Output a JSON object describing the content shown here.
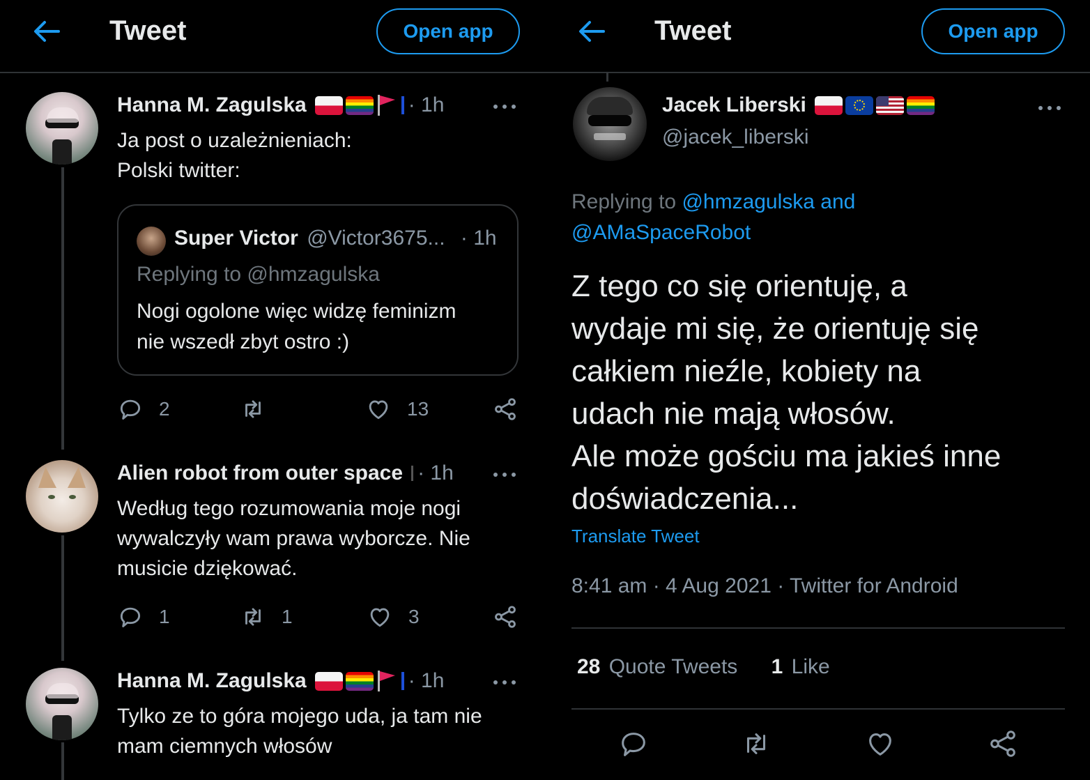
{
  "left": {
    "header": {
      "title": "Tweet",
      "open_app": "Open app"
    },
    "tweets": [
      {
        "name": "Hanna M. Zagulska",
        "time": "· 1h",
        "lines": [
          "Ja post o uzależnieniach:",
          "Polski twitter:"
        ],
        "quote": {
          "name": "Super Victor",
          "handle": "@Victor3675...",
          "time": "· 1h",
          "replying_to": "Replying to @hmzagulska",
          "lines": [
            "Nogi ogolone więc widzę feminizm",
            "nie wszedł zbyt ostro :)"
          ]
        },
        "reply_count": "2",
        "retweet_count": "",
        "like_count": "13"
      },
      {
        "name": "Alien robot from outer space",
        "time": "· 1h",
        "lines": [
          "Według tego rozumowania moje nogi",
          "wywalczyły wam prawa wyborcze. Nie",
          "musicie dziękować."
        ],
        "reply_count": "1",
        "retweet_count": "1",
        "like_count": "3"
      },
      {
        "name": "Hanna M. Zagulska",
        "time": "· 1h",
        "lines": [
          "Tylko ze to góra mojego uda, ja tam nie",
          "mam ciemnych włosów"
        ]
      }
    ]
  },
  "right": {
    "header": {
      "title": "Tweet",
      "open_app": "Open app"
    },
    "author": {
      "name": "Jacek Liberski",
      "handle": "@jacek_liberski"
    },
    "replying_label": "Replying to",
    "replying_users_line1": "@hmzagulska and",
    "replying_users_line2": "@AMaSpaceRobot",
    "body_lines": [
      "Z tego co się orientuję, a",
      "wydaje mi się, że orientuję się",
      "całkiem nieźle, kobiety na",
      "udach nie mają włosów.",
      "Ale może gościu ma jakieś inne",
      "doświadczenia..."
    ],
    "translate": "Translate Tweet",
    "timestamp": "8:41 am · 4 Aug 2021 · Twitter for Android",
    "stats": {
      "quote_count": "28",
      "quote_label": "Quote Tweets",
      "like_count": "1",
      "like_label": "Like"
    }
  },
  "colors": {
    "background": "#000000",
    "accent": "#1d9bf0",
    "muted": "#8b98a5",
    "divider": "#2f3336"
  },
  "icons": [
    "back-arrow-icon",
    "more-icon",
    "reply-icon",
    "retweet-icon",
    "like-icon",
    "share-icon"
  ]
}
